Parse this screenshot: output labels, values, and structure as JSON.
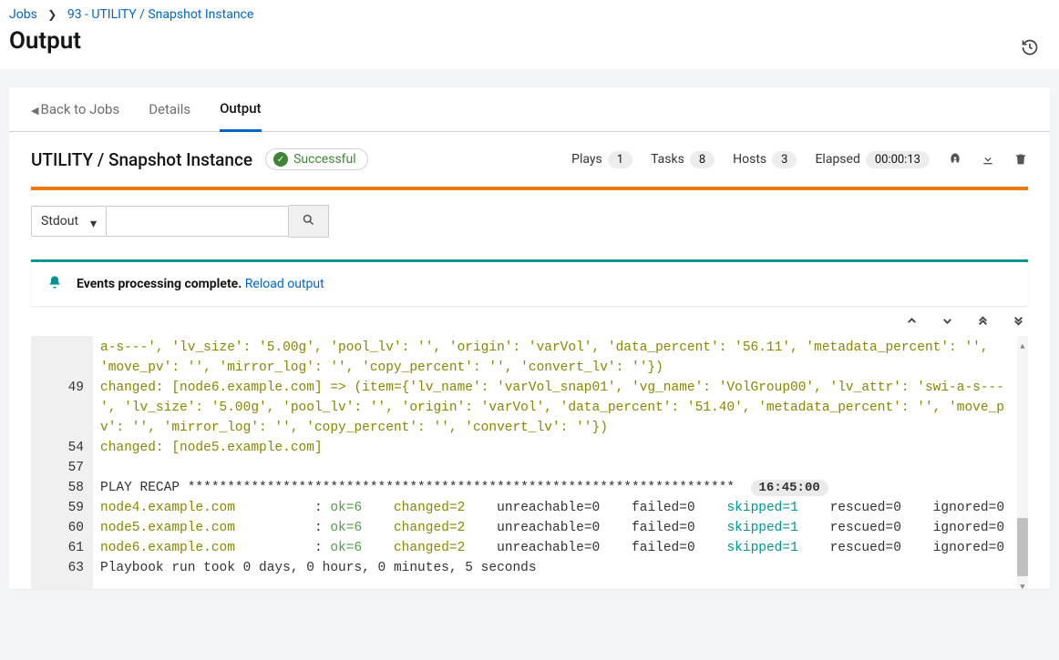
{
  "breadcrumb": {
    "jobs": "Jobs",
    "current": "93 - UTILITY / Snapshot Instance"
  },
  "page_title": "Output",
  "back_link": "Back to Jobs",
  "tabs": {
    "details": "Details",
    "output": "Output"
  },
  "job_title": "UTILITY / Snapshot Instance",
  "status": {
    "label": "Successful",
    "check": "✓"
  },
  "stats": {
    "plays_label": "Plays",
    "plays": "1",
    "tasks_label": "Tasks",
    "tasks": "8",
    "hosts_label": "Hosts",
    "hosts": "3",
    "elapsed_label": "Elapsed",
    "elapsed": "00:00:13"
  },
  "filter": {
    "mode": "Stdout",
    "search_placeholder": ""
  },
  "alert": {
    "text": "Events processing complete.",
    "link": "Reload output"
  },
  "output": {
    "lines": [
      {
        "n": "",
        "segs": [
          {
            "t": "a-s---', 'lv_size': '5.00g', 'pool_lv': '', 'origin': 'varVol', 'data_percent': '56.11', 'metadata_percent': '', 'move_pv': '', 'mirror_log': '', 'copy_percent': '', 'convert_lv': ''})",
            "c": "olive"
          }
        ]
      },
      {
        "n": "49",
        "segs": [
          {
            "t": "changed: [node6.example.com] => (item={'lv_name': 'varVol_snap01', 'vg_name': 'VolGroup00', 'lv_attr': 'swi-a-s---', 'lv_size': '5.00g', 'pool_lv': '', 'origin': 'varVol', 'data_percent': '51.40', 'metadata_percent': '', 'move_pv': '', 'mirror_log': '', 'copy_percent': '', 'convert_lv': ''})",
            "c": "olive"
          }
        ]
      },
      {
        "n": "54",
        "segs": [
          {
            "t": "changed: [node5.example.com]",
            "c": "olive"
          }
        ]
      },
      {
        "n": "57",
        "segs": [
          {
            "t": "",
            "c": "plain"
          }
        ]
      },
      {
        "n": "58",
        "segs": [
          {
            "t": "PLAY RECAP *********************************************************************",
            "c": "plain"
          },
          {
            "t": "  ",
            "c": "plain"
          },
          {
            "t": "16:45:00",
            "c": "ts"
          }
        ]
      },
      {
        "n": "59",
        "segs": [
          {
            "t": "node4.example.com",
            "c": "olive"
          },
          {
            "t": "          : ",
            "c": "plain"
          },
          {
            "t": "ok=6",
            "c": "green"
          },
          {
            "t": "    ",
            "c": "plain"
          },
          {
            "t": "changed=2",
            "c": "olive"
          },
          {
            "t": "    unreachable=0    failed=0    ",
            "c": "plain"
          },
          {
            "t": "skipped=1",
            "c": "teal"
          },
          {
            "t": "    rescued=0    ignored=0",
            "c": "plain"
          }
        ]
      },
      {
        "n": "60",
        "segs": [
          {
            "t": "node5.example.com",
            "c": "olive"
          },
          {
            "t": "          : ",
            "c": "plain"
          },
          {
            "t": "ok=6",
            "c": "green"
          },
          {
            "t": "    ",
            "c": "plain"
          },
          {
            "t": "changed=2",
            "c": "olive"
          },
          {
            "t": "    unreachable=0    failed=0    ",
            "c": "plain"
          },
          {
            "t": "skipped=1",
            "c": "teal"
          },
          {
            "t": "    rescued=0    ignored=0",
            "c": "plain"
          }
        ]
      },
      {
        "n": "61",
        "segs": [
          {
            "t": "node6.example.com",
            "c": "olive"
          },
          {
            "t": "          : ",
            "c": "plain"
          },
          {
            "t": "ok=6",
            "c": "green"
          },
          {
            "t": "    ",
            "c": "plain"
          },
          {
            "t": "changed=2",
            "c": "olive"
          },
          {
            "t": "    unreachable=0    failed=0    ",
            "c": "plain"
          },
          {
            "t": "skipped=1",
            "c": "teal"
          },
          {
            "t": "    rescued=0    ignored=0",
            "c": "plain"
          }
        ]
      },
      {
        "n": "63",
        "segs": [
          {
            "t": "Playbook run took 0 days, 0 hours, 0 minutes, 5 seconds",
            "c": "plain"
          }
        ]
      }
    ]
  }
}
